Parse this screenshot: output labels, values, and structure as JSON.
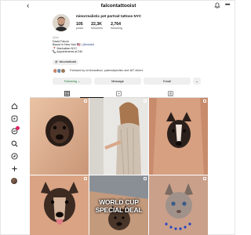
{
  "header": {
    "back_icon": "arrow-left-icon",
    "handle": "falcontattooist",
    "bell_icon": "bell-icon",
    "more_icon": "more-dots-icon"
  },
  "profile": {
    "display_name": "minorrealistic pet portrait tattoos NYC",
    "stats": [
      {
        "value": "105",
        "label": "posts"
      },
      {
        "value": "22,3K",
        "label": "followers"
      },
      {
        "value": "2,764",
        "label": "following"
      }
    ],
    "bio": {
      "handle_small": "@falc",
      "name": "David Falcon",
      "location": "Based in New York",
      "tag": "@inkwild",
      "studio": "Manhattan NYC",
      "appointments": "Appointments at DM"
    },
    "threads_pill": "falcontattooist",
    "followed_by": "Followed by iol.femaniiezz, paternalpezfiez and 487 others"
  },
  "actions": {
    "follow": "Following ⌄",
    "message": "Message",
    "email": "Email",
    "more": "⌄"
  },
  "tabs": [
    {
      "name": "grid",
      "icon": "grid-icon"
    },
    {
      "name": "reels",
      "icon": "reels-icon"
    },
    {
      "name": "tagged",
      "icon": "tagged-icon"
    }
  ],
  "posts": [
    {
      "overlay": ""
    },
    {
      "overlay": ""
    },
    {
      "overlay": ""
    },
    {
      "overlay": ""
    },
    {
      "overlay": "WORLD CUP SPECIAL DEAL"
    },
    {
      "overlay": ""
    }
  ],
  "rail": [
    {
      "icon": "home-icon"
    },
    {
      "icon": "reels-icon"
    },
    {
      "icon": "messages-icon"
    },
    {
      "icon": "search-icon"
    },
    {
      "icon": "explore-icon"
    },
    {
      "icon": "create-icon"
    },
    {
      "icon": "profile-avatar-icon"
    }
  ],
  "colors": {
    "follow_text": "#1a7f37",
    "badge": "#e0245e",
    "link": "#2d4d89"
  }
}
